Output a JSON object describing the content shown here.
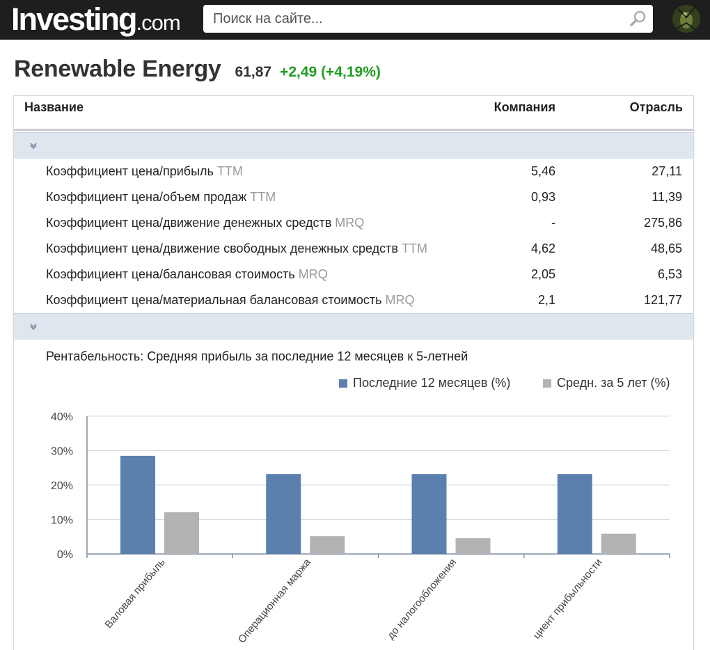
{
  "header": {
    "logo_main": "Investing",
    "logo_suffix": ".com",
    "search_placeholder": "Поиск на сайте..."
  },
  "instrument": {
    "title": "Renewable Energy",
    "price": "61,87",
    "change": "+2,49 (+4,19%)"
  },
  "table": {
    "columns": [
      "Название",
      "Компания",
      "Отрасль"
    ],
    "rows": [
      {
        "label": "Коэффициент цена/прибыль",
        "suffix": "TTM",
        "company": "5,46",
        "industry": "27,11"
      },
      {
        "label": "Коэффициент цена/объем продаж",
        "suffix": "TTM",
        "company": "0,93",
        "industry": "11,39"
      },
      {
        "label": "Коэффициент цена/движение денежных средств",
        "suffix": "MRQ",
        "company": "-",
        "industry": "275,86"
      },
      {
        "label": "Коэффициент цена/движение свободных денежных средств",
        "suffix": "TTM",
        "company": "4,62",
        "industry": "48,65"
      },
      {
        "label": "Коэффициент цена/балансовая стоимость",
        "suffix": "MRQ",
        "company": "2,05",
        "industry": "6,53"
      },
      {
        "label": "Коэффициент цена/материальная балансовая стоимость",
        "suffix": "MRQ",
        "company": "2,1",
        "industry": "121,77"
      }
    ]
  },
  "colors": {
    "positive": "#1f9e1f",
    "series_recent": "#5b80ae",
    "series_avg": "#b3b3b3"
  },
  "chart_data": {
    "type": "bar",
    "title": "Рентабельность: Средняя прибыль за последние 12 месяцев к 5-летней",
    "categories": [
      "Валовая прибыль",
      "Операционная маржа",
      "до налогообложения",
      "циент прибыльности"
    ],
    "series": [
      {
        "name": "Последние 12 месяцев (%)",
        "values": [
          28.5,
          23.2,
          23.2,
          23.2
        ]
      },
      {
        "name": "Средн. за 5 лет (%)",
        "values": [
          12.1,
          5.2,
          4.6,
          5.9
        ]
      }
    ],
    "yticks": [
      "40%",
      "30%",
      "20%",
      "10%",
      "0%"
    ],
    "ylim": [
      0,
      40
    ],
    "grid": true,
    "legend_position": "top-right"
  }
}
